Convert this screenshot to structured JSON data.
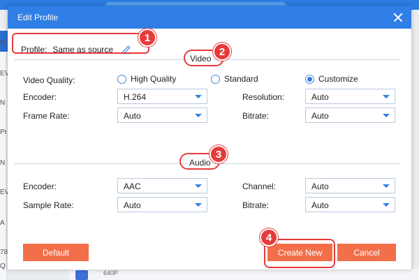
{
  "dialog": {
    "title": "Edit Profile",
    "profile_label": "Profile:",
    "profile_value": "Same as source",
    "video_section": "Video",
    "audio_section": "Audio"
  },
  "video": {
    "quality_label": "Video Quality:",
    "quality_options": [
      "High Quality",
      "Standard",
      "Customize"
    ],
    "quality_selected": "Customize",
    "encoder_label": "Encoder:",
    "encoder_value": "H.264",
    "resolution_label": "Resolution:",
    "resolution_value": "Auto",
    "framerate_label": "Frame Rate:",
    "framerate_value": "Auto",
    "bitrate_label": "Bitrate:",
    "bitrate_value": "Auto"
  },
  "audio": {
    "encoder_label": "Encoder:",
    "encoder_value": "AAC",
    "channel_label": "Channel:",
    "channel_value": "Auto",
    "samplerate_label": "Sample Rate:",
    "samplerate_value": "Auto",
    "bitrate_label": "Bitrate:",
    "bitrate_value": "Auto"
  },
  "buttons": {
    "default": "Default",
    "create_new": "Create New",
    "cancel": "Cancel"
  },
  "annotations": [
    "1",
    "2",
    "3",
    "4"
  ],
  "background": {
    "left_fragments": [
      "N",
      "EV",
      "N",
      "Pr",
      "N",
      "EV",
      "A",
      "78",
      "Q"
    ],
    "bottom_text": "640P"
  },
  "colors": {
    "titlebar": "#2f7fe6",
    "button": "#f26f4a",
    "highlight": "#e53b3b"
  }
}
